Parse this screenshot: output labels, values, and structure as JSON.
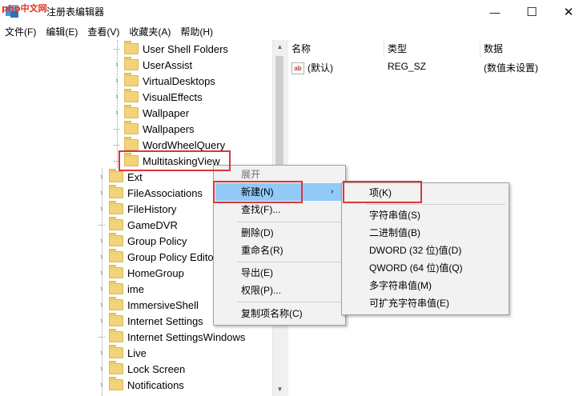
{
  "window": {
    "title": "注册表编辑器",
    "watermark": "php中文网",
    "controls": {
      "minimize": "—",
      "maximize": "☐",
      "close": "✕"
    }
  },
  "menubar": [
    "文件(F)",
    "编辑(E)",
    "查看(V)",
    "收藏夹(A)",
    "帮助(H)"
  ],
  "tree": {
    "items": [
      {
        "label": "User Shell Folders",
        "expandable": false
      },
      {
        "label": "UserAssist",
        "expandable": true
      },
      {
        "label": "VirtualDesktops",
        "expandable": true
      },
      {
        "label": "VisualEffects",
        "expandable": true
      },
      {
        "label": "Wallpaper",
        "expandable": true
      },
      {
        "label": "Wallpapers",
        "expandable": false
      },
      {
        "label": "WordWheelQuery",
        "expandable": false
      },
      {
        "label": "MultitaskingView",
        "expandable": false,
        "selected": true
      },
      {
        "label": "Ext",
        "expandable": true
      },
      {
        "label": "FileAssociations",
        "expandable": true
      },
      {
        "label": "FileHistory",
        "expandable": true
      },
      {
        "label": "GameDVR",
        "expandable": false
      },
      {
        "label": "Group Policy",
        "expandable": true
      },
      {
        "label": "Group Policy Editor",
        "expandable": true
      },
      {
        "label": "HomeGroup",
        "expandable": true
      },
      {
        "label": "ime",
        "expandable": true
      },
      {
        "label": "ImmersiveShell",
        "expandable": true
      },
      {
        "label": "Internet Settings",
        "expandable": true
      },
      {
        "label": "Internet SettingsWindows",
        "expandable": false
      },
      {
        "label": "Live",
        "expandable": true
      },
      {
        "label": "Lock Screen",
        "expandable": true
      },
      {
        "label": "Notifications",
        "expandable": true
      }
    ]
  },
  "list": {
    "headers": [
      "名称",
      "类型",
      "数据"
    ],
    "rows": [
      {
        "icon": "ab",
        "name": "(默认)",
        "type": "REG_SZ",
        "data": "(数值未设置)"
      }
    ]
  },
  "context_menu": {
    "header": "展开",
    "new_label": "新建(N)",
    "items": [
      "查找(F)...",
      "删除(D)",
      "重命名(R)",
      "导出(E)",
      "权限(P)...",
      "复制项名称(C)"
    ]
  },
  "submenu": {
    "first": "项(K)",
    "items": [
      "字符串值(S)",
      "二进制值(B)",
      "DWORD (32 位)值(D)",
      "QWORD (64 位)值(Q)",
      "多字符串值(M)",
      "可扩充字符串值(E)"
    ]
  },
  "colors": {
    "highlight_border": "#d9373a",
    "menu_highlight": "#91c9f7"
  }
}
